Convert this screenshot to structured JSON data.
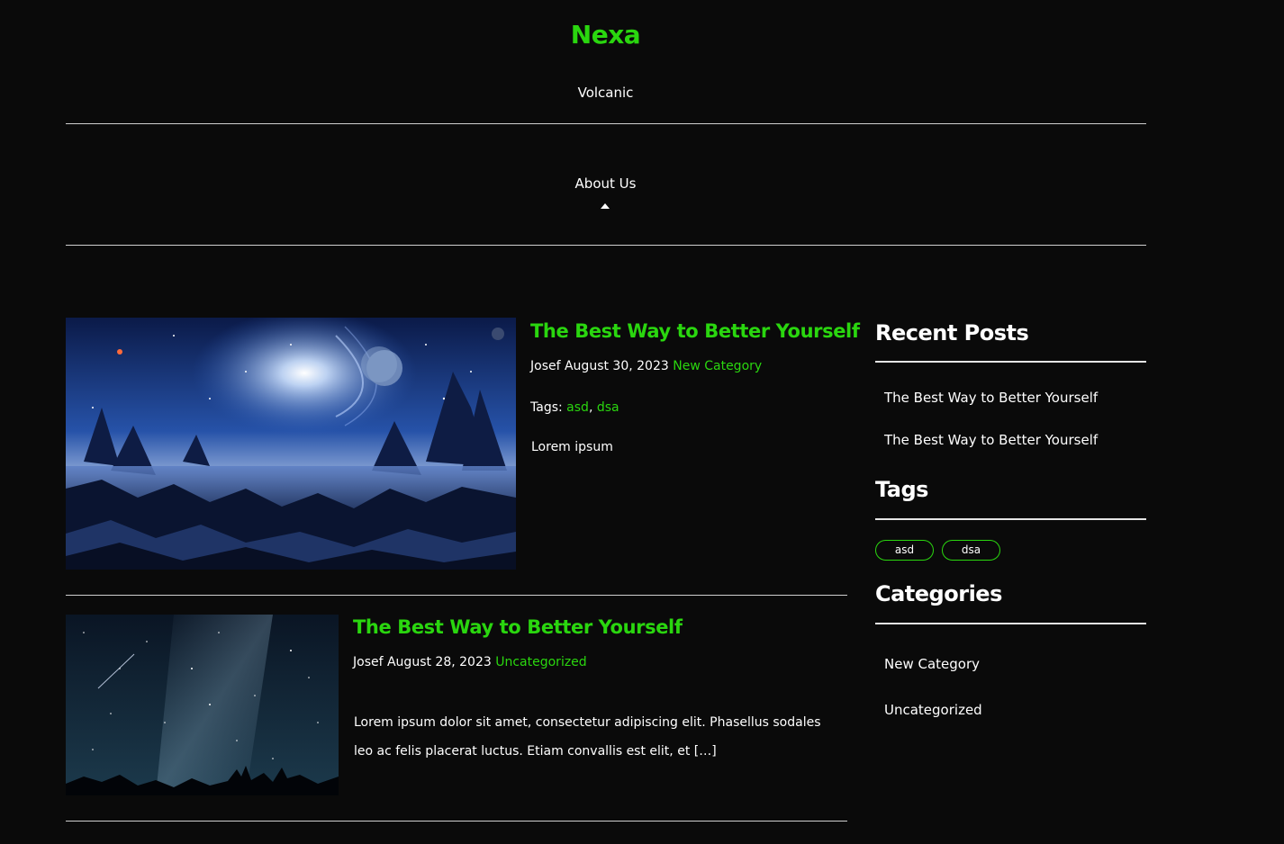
{
  "site": {
    "title": "Nexa",
    "tagline": "Volcanic"
  },
  "nav": {
    "items": [
      {
        "label": "About Us"
      }
    ]
  },
  "posts": [
    {
      "title": "The Best Way to Better Yourself",
      "author": "Josef",
      "date": "August 30, 2023",
      "category": "New Category",
      "tags_label": "Tags:",
      "tags": [
        "asd",
        "dsa"
      ],
      "tags_separator": ", ",
      "excerpt": "Lorem ipsum",
      "image": "alien-lake-landscape"
    },
    {
      "title": "The Best Way to Better Yourself",
      "author": "Josef",
      "date": "August 28, 2023",
      "category": "Uncategorized",
      "excerpt": "Lorem ipsum dolor sit amet, consectetur adipiscing elit. Phasellus sodales leo ac felis placerat luctus. Etiam convallis est elit, et […]",
      "image": "milky-way-night-sky"
    }
  ],
  "sidebar": {
    "recent_posts": {
      "title": "Recent Posts",
      "items": [
        "The Best Way to Better Yourself",
        "The Best Way to Better Yourself"
      ]
    },
    "tags": {
      "title": "Tags",
      "items": [
        "asd",
        "dsa"
      ]
    },
    "categories": {
      "title": "Categories",
      "items": [
        "New Category",
        "Uncategorized"
      ]
    }
  },
  "colors": {
    "background": "#0a0a0a",
    "accent": "#2ad60f",
    "text": "#ffffff",
    "rule": "#cfcfcf"
  },
  "icons": {
    "nav_caret": "caret-up-icon"
  }
}
